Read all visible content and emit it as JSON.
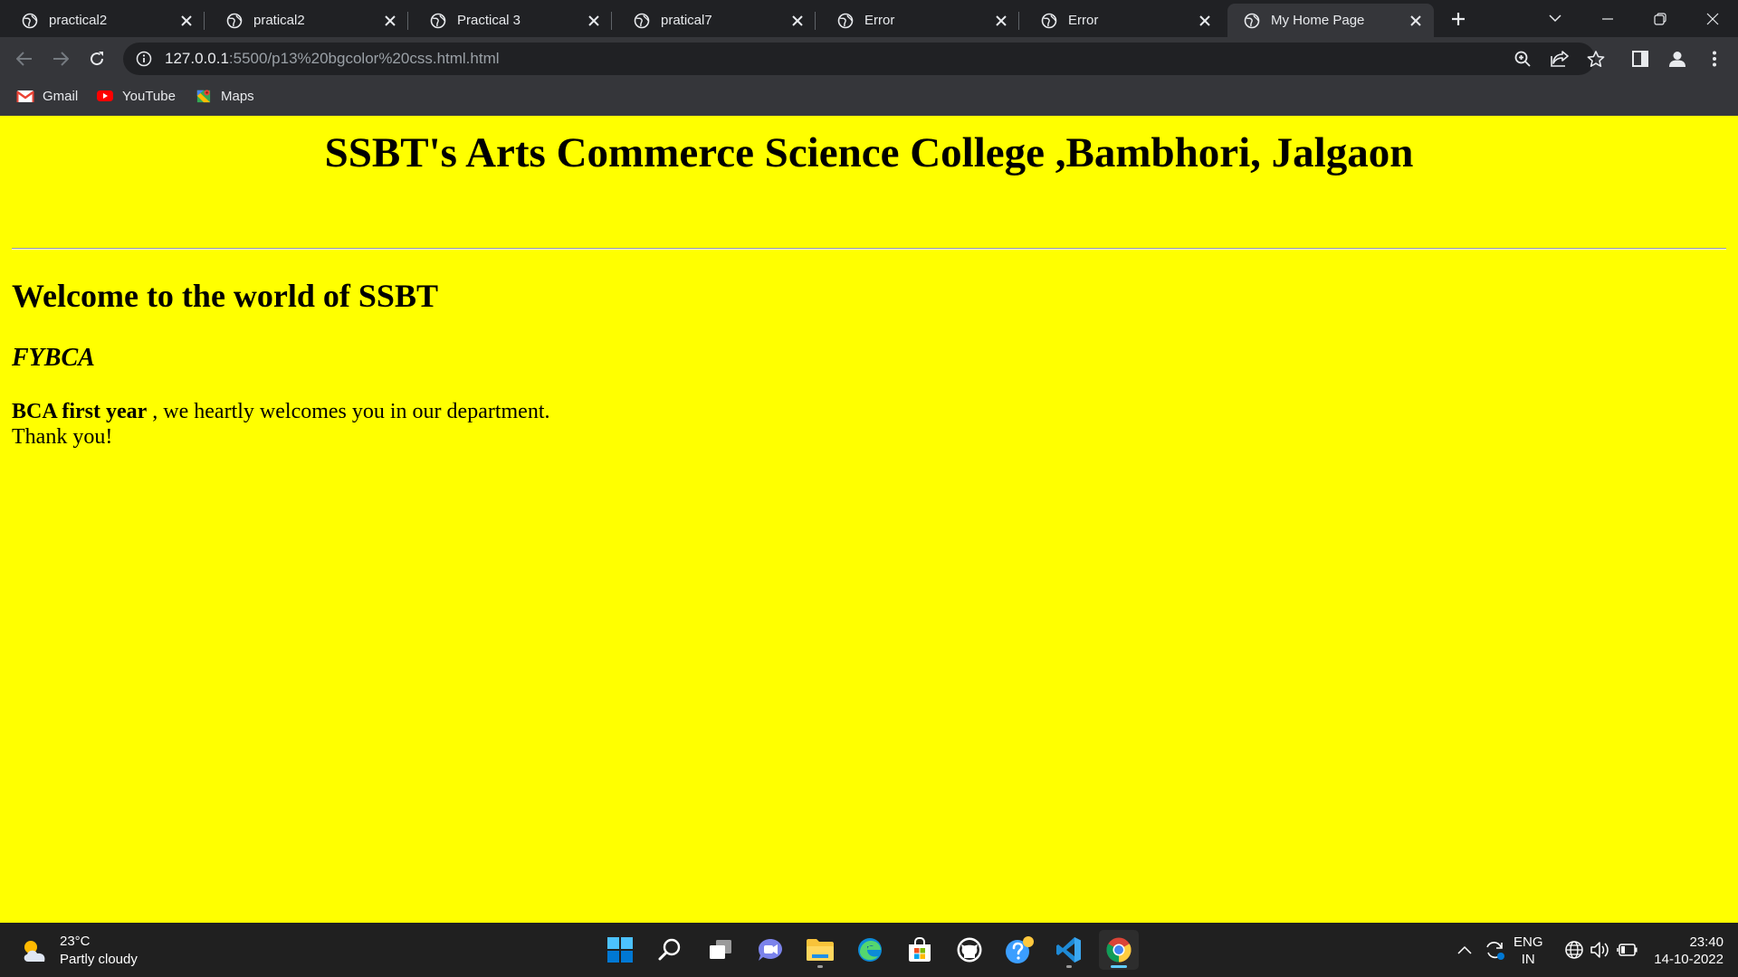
{
  "browser": {
    "tabs": [
      {
        "title": "practical2",
        "active": false
      },
      {
        "title": "pratical2",
        "active": false
      },
      {
        "title": "Practical 3",
        "active": false
      },
      {
        "title": "pratical7",
        "active": false
      },
      {
        "title": "Error",
        "active": false
      },
      {
        "title": "Error",
        "active": false
      },
      {
        "title": "My Home Page",
        "active": true
      }
    ],
    "address": {
      "host": "127.0.0.1",
      "path": ":5500/p13%20bgcolor%20css.html.html"
    },
    "bookmarks": [
      {
        "label": "Gmail",
        "icon": "gmail-icon"
      },
      {
        "label": "YouTube",
        "icon": "youtube-icon"
      },
      {
        "label": "Maps",
        "icon": "maps-icon"
      }
    ]
  },
  "page": {
    "background": "#ffff00",
    "heading": "SSBT's Arts Commerce Science College ,Bambhori, Jalgaon",
    "welcome": "Welcome to the world of SSBT",
    "course": "FYBCA",
    "paragraph": {
      "bold": "BCA first year",
      "text": " , we heartly welcomes you in our department.",
      "line2": "Thank you!"
    }
  },
  "taskbar": {
    "weather": {
      "temp": "23°C",
      "condition": "Partly cloudy"
    },
    "apps": [
      "start-icon",
      "search-icon",
      "task-view-icon",
      "chat-icon",
      "file-explorer-icon",
      "edge-icon",
      "store-icon",
      "github-icon",
      "help-icon",
      "vscode-icon",
      "chrome-icon"
    ],
    "language": {
      "line1": "ENG",
      "line2": "IN"
    },
    "clock": {
      "time": "23:40",
      "date": "14-10-2022"
    }
  }
}
